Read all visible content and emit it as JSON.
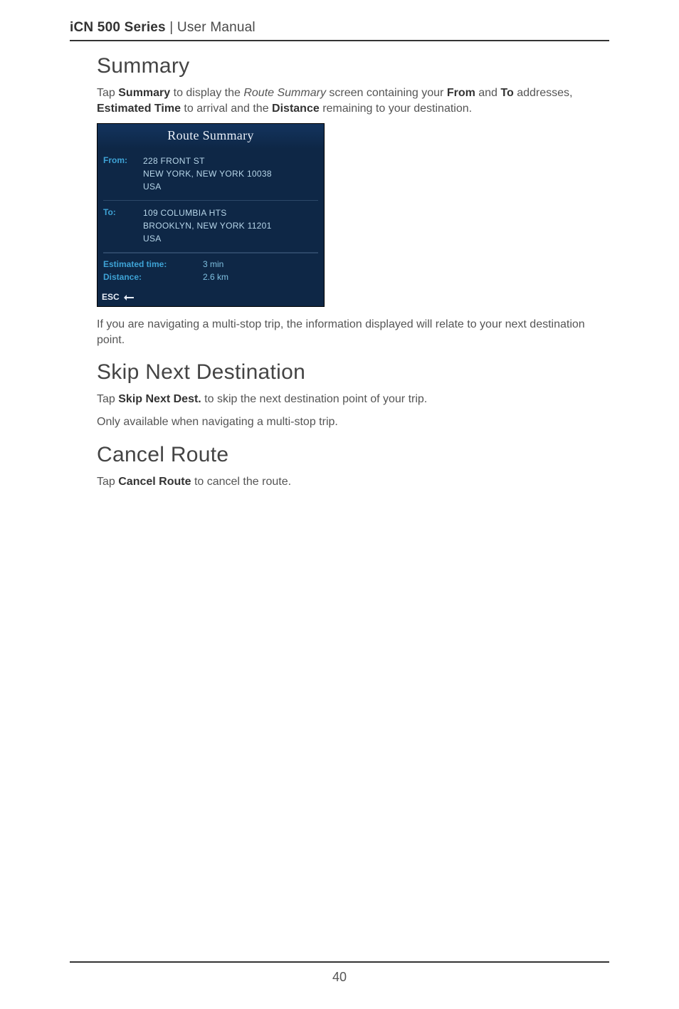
{
  "header": {
    "product": "iCN 500 Series",
    "sep": " | ",
    "doc": "User Manual"
  },
  "summary": {
    "heading": "Summary",
    "p1_pre": "Tap ",
    "p1_b1": "Summary",
    "p1_mid1": " to display the ",
    "p1_i": "Route Summary",
    "p1_mid2": " screen containing your ",
    "p1_b2": "From",
    "p1_mid3": " and ",
    "p1_b3": "To",
    "p1_mid4": " addresses, ",
    "p1_b4": "Estimated Time",
    "p1_mid5": " to arrival and the ",
    "p1_b5": "Distance",
    "p1_tail": " remaining to your destination.",
    "p2": "If you are navigating a multi-stop trip, the information displayed will relate to your next destination point."
  },
  "device": {
    "title": "Route Summary",
    "from_label": "From:",
    "from_line1": "228 FRONT ST",
    "from_line2": "NEW YORK, NEW YORK 10038",
    "from_line3": "USA",
    "to_label": "To:",
    "to_line1": "109 COLUMBIA HTS",
    "to_line2": "BROOKLYN, NEW YORK 11201",
    "to_line3": "USA",
    "est_label": "Estimated time:",
    "est_value": "3 min",
    "dist_label": "Distance:",
    "dist_value": "2.6 km",
    "esc": "ESC"
  },
  "skip": {
    "heading": "Skip Next Destination",
    "p1_pre": "Tap ",
    "p1_b": "Skip Next Dest.",
    "p1_tail": " to skip the next destination point of your trip.",
    "p2": "Only available when navigating a multi-stop trip."
  },
  "cancel": {
    "heading": "Cancel Route",
    "p1_pre": "Tap ",
    "p1_b": "Cancel Route",
    "p1_tail": " to cancel the route."
  },
  "footer": {
    "page": "40"
  }
}
